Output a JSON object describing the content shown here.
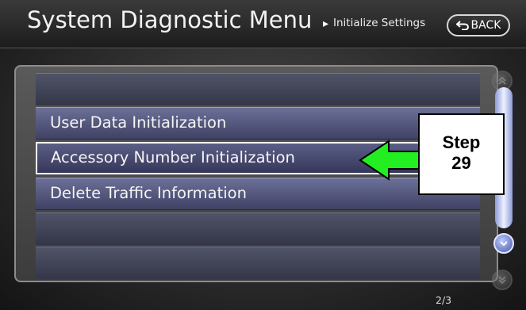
{
  "header": {
    "title": "System Diagnostic Menu",
    "breadcrumb_arrow": "▸",
    "breadcrumb": "Initialize Settings",
    "back_label": "BACK"
  },
  "menu": {
    "items": [
      {
        "label": "User Data Initialization",
        "selected": false
      },
      {
        "label": "Accessory Number Initialization",
        "selected": true
      },
      {
        "label": "Delete Traffic Information",
        "selected": false
      }
    ]
  },
  "page_indicator": "2/3",
  "callout": {
    "line1": "Step",
    "line2": "29",
    "arrow_color": "#22ee22"
  },
  "colors": {
    "row_active": "#5b5f86",
    "scroll_active": "#8d9ad8"
  },
  "icons": [
    "back-arrow-icon",
    "scroll-top-icon",
    "scroll-up-icon",
    "scroll-down-icon",
    "scroll-bottom-icon"
  ]
}
